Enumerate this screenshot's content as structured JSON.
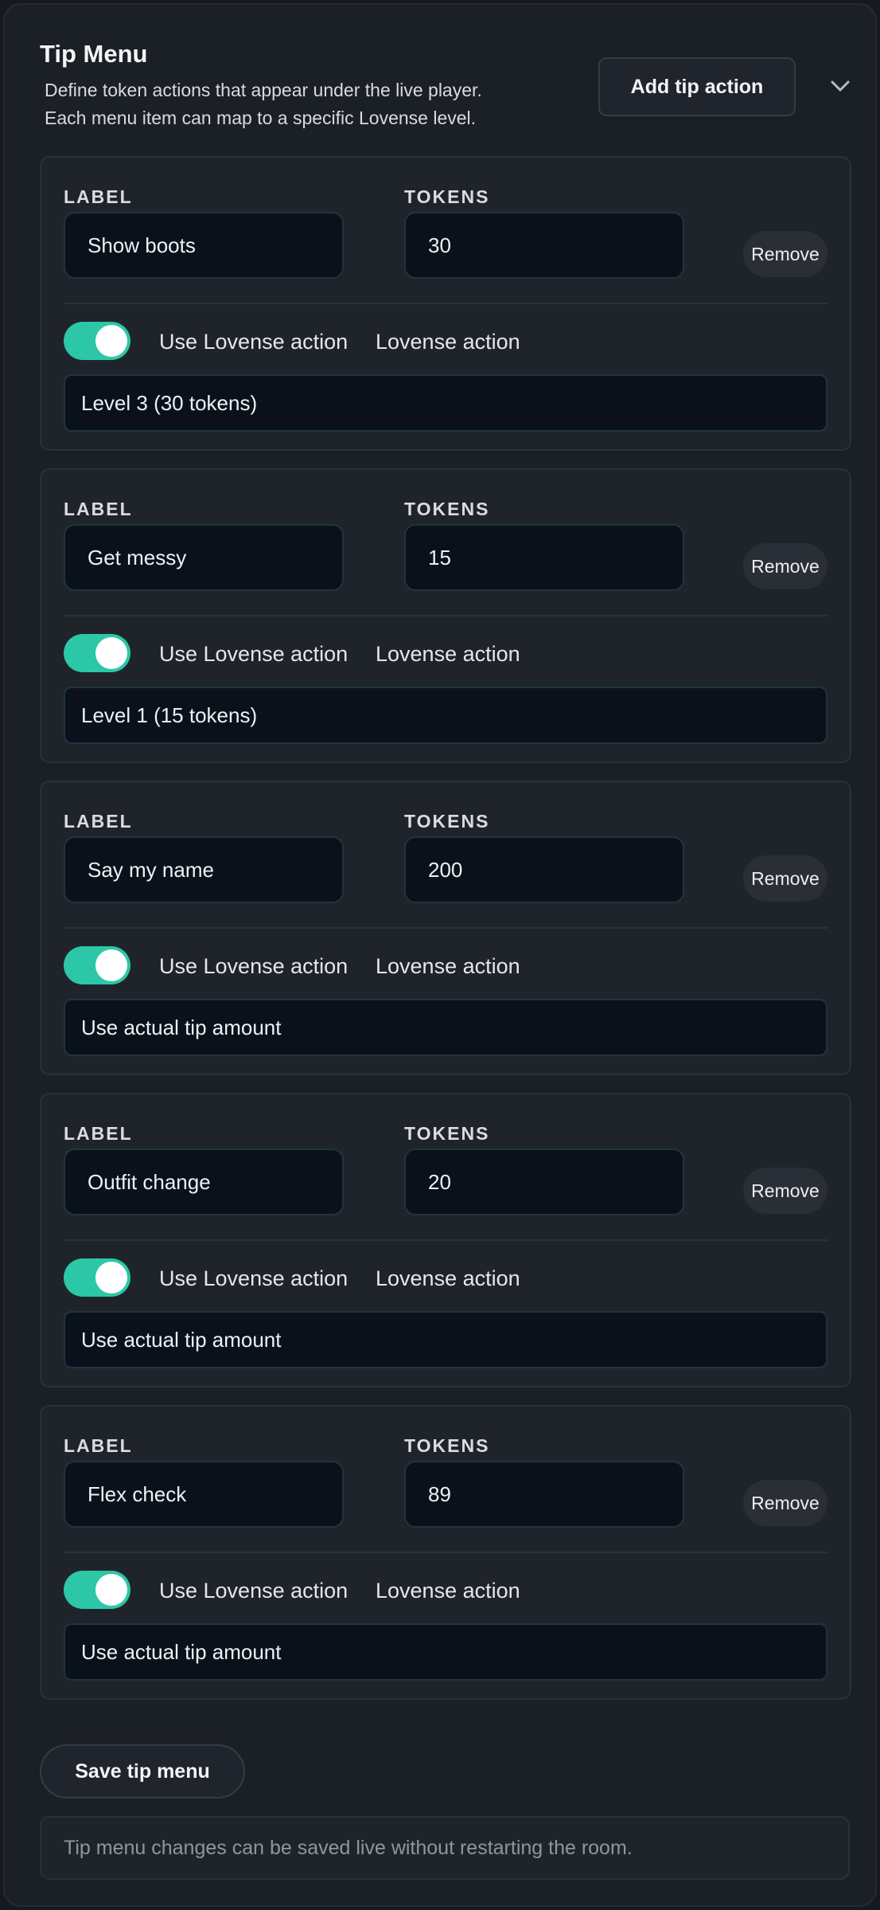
{
  "header": {
    "title": "Tip Menu",
    "description_line1": "Define token actions that appear under the live player.",
    "description_line2": "Each menu item can map to a specific Lovense level.",
    "add_button": "Add tip action"
  },
  "field_labels": {
    "label": "LABEL",
    "tokens": "TOKENS"
  },
  "items": [
    {
      "label": "Show boots",
      "tokens": "30",
      "remove": "Remove",
      "toggle_on": true,
      "toggle_label": "Use Lovense action",
      "action_label": "Lovense action",
      "action_value": "Level 3 (30 tokens)"
    },
    {
      "label": "Get messy",
      "tokens": "15",
      "remove": "Remove",
      "toggle_on": true,
      "toggle_label": "Use Lovense action",
      "action_label": "Lovense action",
      "action_value": "Level 1 (15 tokens)"
    },
    {
      "label": "Say my name",
      "tokens": "200",
      "remove": "Remove",
      "toggle_on": true,
      "toggle_label": "Use Lovense action",
      "action_label": "Lovense action",
      "action_value": "Use actual tip amount"
    },
    {
      "label": "Outfit change",
      "tokens": "20",
      "remove": "Remove",
      "toggle_on": true,
      "toggle_label": "Use Lovense action",
      "action_label": "Lovense action",
      "action_value": "Use actual tip amount"
    },
    {
      "label": "Flex check",
      "tokens": "89",
      "remove": "Remove",
      "toggle_on": true,
      "toggle_label": "Use Lovense action",
      "action_label": "Lovense action",
      "action_value": "Use actual tip amount"
    }
  ],
  "footer": {
    "save_button": "Save tip menu",
    "note": "Tip menu changes can be saved live without restarting the room."
  },
  "colors": {
    "background": "#1b1f26",
    "card": "#1f242b",
    "input": "#0b111b",
    "toggle_accent": "#2cc7a6",
    "muted_text": "#8f96a0"
  },
  "icons": {
    "collapse": "chevron-down-icon"
  }
}
